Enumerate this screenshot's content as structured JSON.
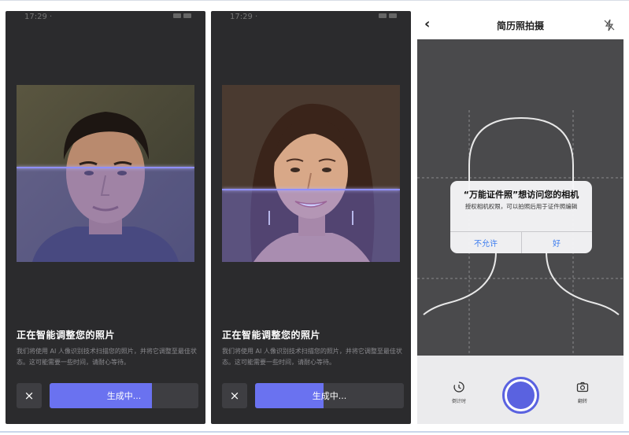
{
  "panels": [
    {
      "status_time": "17:29 ·",
      "title": "正在智能调整您的照片",
      "description": "我们将使用 AI 人像识别技术扫描您的照片，并将它调整至最佳状态。这可能需要一些时间，请耐心等待。",
      "close_icon": "×",
      "generate_label": "生成中...",
      "progress": 0.69,
      "person": "man"
    },
    {
      "status_time": "17:29 ·",
      "title": "正在智能调整您的照片",
      "description": "我们将使用 AI 人像识别技术扫描您的照片，并将它调整至最佳状态。这可能需要一些时间，请耐心等待。",
      "close_icon": "×",
      "generate_label": "生成中...",
      "progress": 0.46,
      "person": "woman"
    }
  ],
  "camera": {
    "nav_title": "简历照拍摄",
    "back_icon": "‹",
    "flash_icon": "flash-off-icon",
    "dialog": {
      "title": "“万能证件照”想访问您的相机",
      "message": "授权相机权限，可以拍照后用于证件照编辑",
      "deny_label": "不允许",
      "allow_label": "好"
    },
    "tools": {
      "timer_label": "倒计时",
      "flip_label": "翻转"
    }
  },
  "colors": {
    "phone_bg": "#2b2b2d",
    "accent": "#6a72f0",
    "shutter": "#5a62e0",
    "link_blue": "#3b7cf0"
  }
}
